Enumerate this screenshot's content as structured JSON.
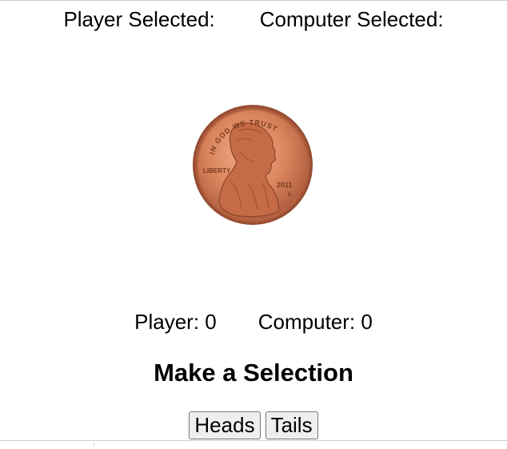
{
  "header": {
    "player_selected_label": "Player Selected:",
    "computer_selected_label": "Computer Selected:"
  },
  "coin": {
    "icon": "penny-heads-icon",
    "motto": "IN GOD WE TRUST",
    "liberty": "LIBERTY",
    "year": "2011",
    "mint_mark": "D",
    "color": "#c8724a"
  },
  "scores": {
    "player_label": "Player:",
    "player_score": "0",
    "computer_label": "Computer:",
    "computer_score": "0"
  },
  "message": "Make a Selection",
  "buttons": {
    "heads_label": "Heads",
    "tails_label": "Tails"
  }
}
